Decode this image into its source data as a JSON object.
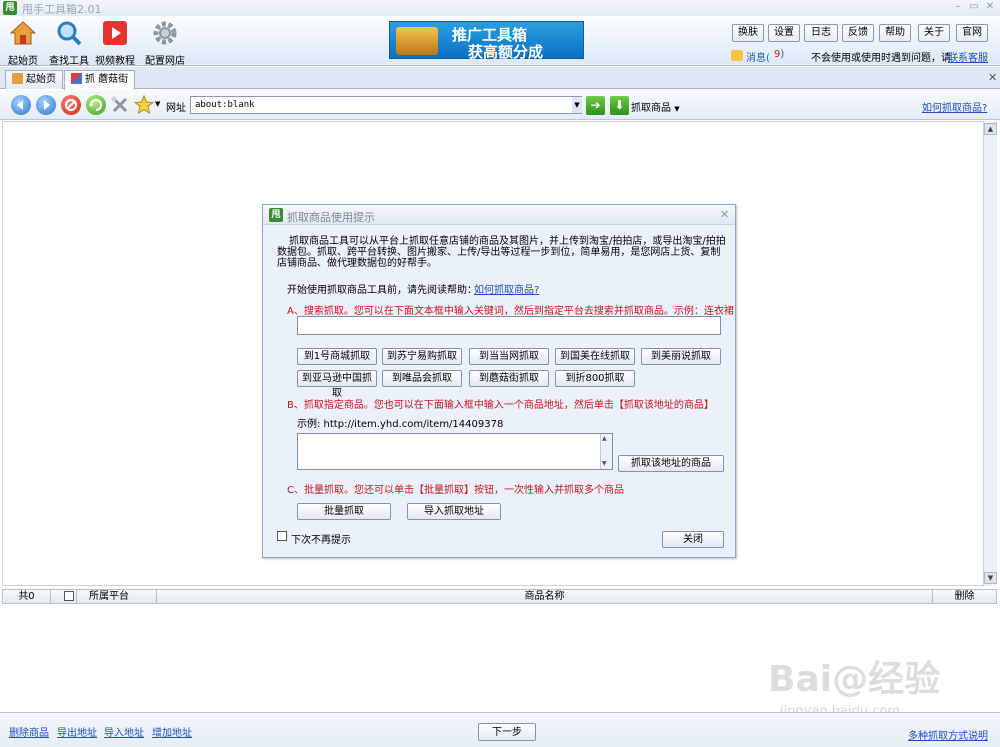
{
  "window": {
    "title": "甩手工具箱2.01",
    "app_icon": "甩"
  },
  "toolbar": {
    "home": "起始页",
    "find_tools": "查找工具",
    "video_tutorial": "视频教程",
    "config_store": "配置网店"
  },
  "banner": {
    "line1": "推广工具箱",
    "line2": "获高额分成"
  },
  "header_buttons": [
    "换肤",
    "设置",
    "日志",
    "反馈",
    "帮助",
    "关于",
    "官网"
  ],
  "messages": {
    "label": "消息(",
    "count": "9",
    "close": ")"
  },
  "help_text": "不会使用或使用时遇到问题，请",
  "contact_link": "联系客服",
  "tabs": {
    "home": "起始页",
    "mogujie": "抓 蘑菇街"
  },
  "navbar": {
    "url_label": "网址",
    "url_value": "about:blank",
    "grab_label": "抓取商品",
    "how_link": "如何抓取商品?"
  },
  "dialog": {
    "title": "抓取商品使用提示",
    "intro": "抓取商品工具可以从平台上抓取任意店铺的商品及其图片，并上传到淘宝/拍拍店，或导出淘宝/拍拍数据包。抓取、跨平台转换、图片搬家、上传/导出等过程一步到位，简单易用，是您网店上货、复制店铺商品、做代理数据包的好帮手。",
    "start_text": "开始使用抓取商品工具前，请先阅读帮助：",
    "start_link": "如何抓取商品?",
    "section_a": "A、搜索抓取。您可以在下面文本框中输入关键词，然后到指定平台去搜索并抓取商品。示例：连衣裙",
    "platform_buttons": [
      "到1号商城抓取",
      "到苏宁易购抓取",
      "到当当网抓取",
      "到国美在线抓取",
      "到美丽说抓取",
      "到亚马逊中国抓取",
      "到唯品会抓取",
      "到蘑菇街抓取",
      "到折800抓取"
    ],
    "section_b": "B、抓取指定商品。您也可以在下面输入框中输入一个商品地址，然后单击【抓取该地址的商品】",
    "example": "示例: http://item.yhd.com/item/14409378",
    "grab_address_button": "抓取该地址的商品",
    "section_c": "C、批量抓取。您还可以单击【批量抓取】按钮，一次性输入并抓取多个商品",
    "batch_button": "批量抓取",
    "import_button": "导入抓取地址",
    "dont_show": "下次不再提示",
    "close_button": "关闭"
  },
  "list": {
    "count": "共0",
    "platform": "所属平台",
    "product_name": "商品名称",
    "delete": "删除"
  },
  "bottom": {
    "links": [
      "删除商品",
      "导出地址",
      "导入地址",
      "增加地址"
    ],
    "next": "下一步",
    "methods_link": "多种抓取方式说明"
  },
  "watermark": {
    "text": "Bai@经验",
    "url": "jingyan.baidu.com"
  }
}
